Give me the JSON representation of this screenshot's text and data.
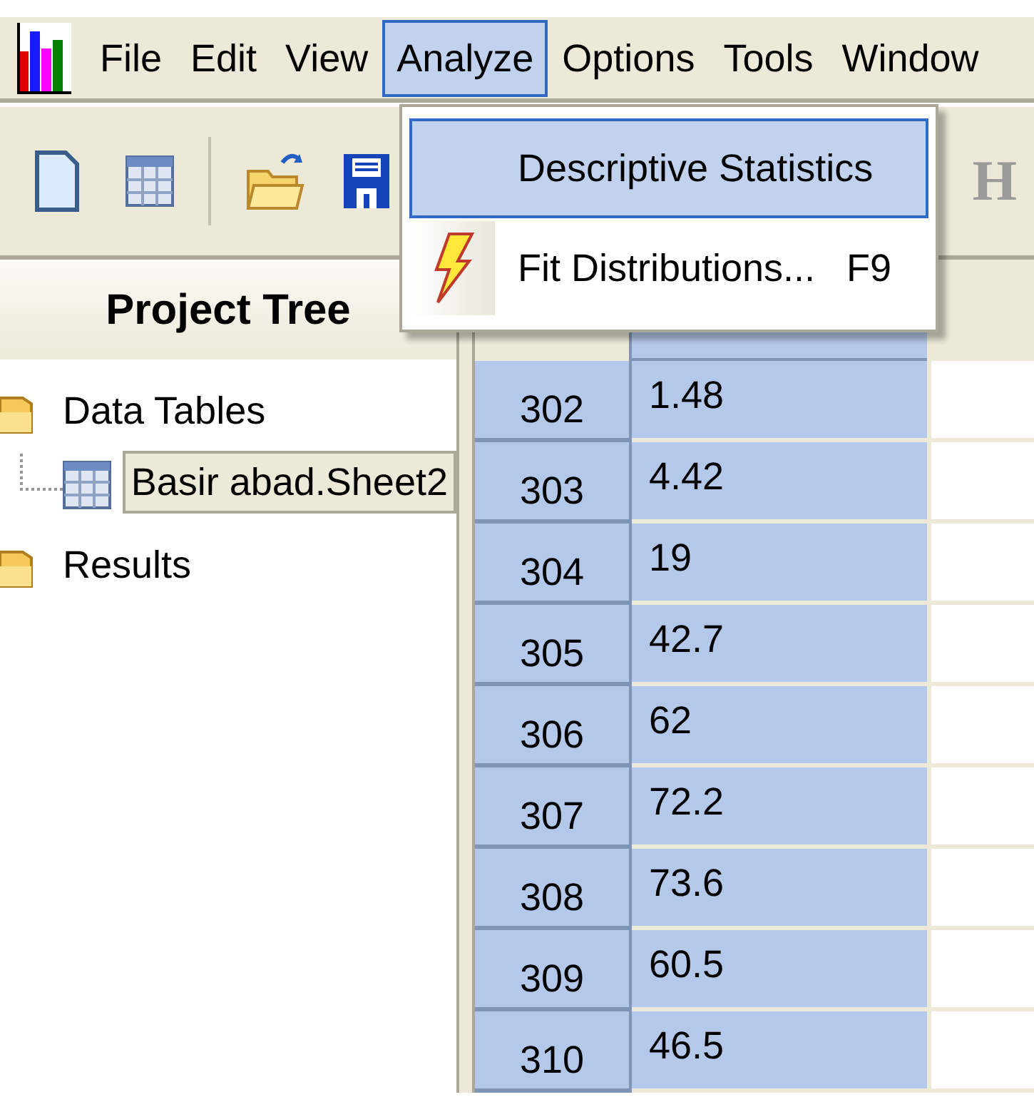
{
  "menu_bar": {
    "items": [
      {
        "label": "File",
        "selected": false
      },
      {
        "label": "Edit",
        "selected": false
      },
      {
        "label": "View",
        "selected": false
      },
      {
        "label": "Analyze",
        "selected": true
      },
      {
        "label": "Options",
        "selected": false
      },
      {
        "label": "Tools",
        "selected": false
      },
      {
        "label": "Window",
        "selected": false
      }
    ]
  },
  "toolbar": {
    "trailing_text": "H"
  },
  "analyze_menu": {
    "items": [
      {
        "label": "Descriptive Statistics",
        "selected": true,
        "kind": "plain"
      },
      {
        "label": "Fit Distributions...",
        "shortcut": "F9",
        "selected": false,
        "kind": "icon"
      }
    ]
  },
  "project_tree": {
    "title": "Project Tree",
    "items": [
      {
        "label": "Data Tables",
        "selected": false,
        "children": [
          {
            "label": "Basir abad.Sheet2",
            "selected": true
          }
        ]
      },
      {
        "label": "Results",
        "selected": false
      }
    ]
  },
  "grid": {
    "rows": [
      {
        "row_number": "302",
        "value": "1.48",
        "selected": true
      },
      {
        "row_number": "303",
        "value": "4.42",
        "selected": true
      },
      {
        "row_number": "304",
        "value": "19",
        "selected": true
      },
      {
        "row_number": "305",
        "value": "42.7",
        "selected": true
      },
      {
        "row_number": "306",
        "value": "62",
        "selected": true
      },
      {
        "row_number": "307",
        "value": "72.2",
        "selected": true
      },
      {
        "row_number": "308",
        "value": "73.6",
        "selected": true
      },
      {
        "row_number": "309",
        "value": "60.5",
        "selected": true
      },
      {
        "row_number": "310",
        "value": "46.5",
        "selected": true
      }
    ]
  }
}
